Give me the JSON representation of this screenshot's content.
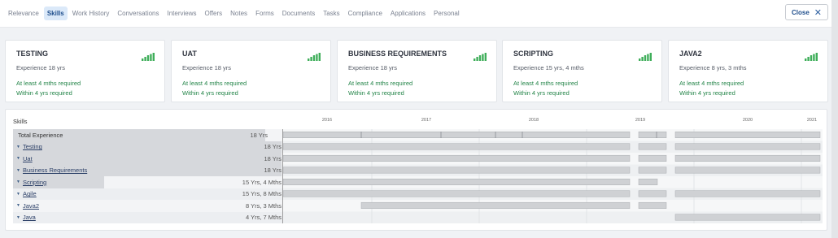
{
  "tabs": [
    "Relevance",
    "Skills",
    "Work History",
    "Conversations",
    "Interviews",
    "Offers",
    "Notes",
    "Forms",
    "Documents",
    "Tasks",
    "Compliance",
    "Applications",
    "Personal"
  ],
  "active_tab": "Skills",
  "close_label": "Close",
  "cards": [
    {
      "title": "TESTING",
      "experience": "Experience 18 yrs",
      "required": "At least 4 mths required",
      "within": "Within 4 yrs required"
    },
    {
      "title": "UAT",
      "experience": "Experience 18 yrs",
      "required": "At least 4 mths required",
      "within": "Within 4 yrs required"
    },
    {
      "title": "BUSINESS REQUIREMENTS",
      "experience": "Experience 18 yrs",
      "required": "At least 4 mths required",
      "within": "Within 4 yrs required"
    },
    {
      "title": "SCRIPTING",
      "experience": "Experience 15 yrs, 4 mths",
      "required": "At least 4 mths required",
      "within": "Within 4 yrs required"
    },
    {
      "title": "JAVA2",
      "experience": "Experience 8 yrs, 3 mths",
      "required": "At least 4 mths required",
      "within": "Within 4 yrs required"
    }
  ],
  "skills_header": "Skills",
  "year_ticks": [
    "2016",
    "2017",
    "2018",
    "2019",
    "2020",
    "2021"
  ],
  "skill_rows": [
    {
      "name": "Total Experience",
      "value": "18 Yrs",
      "total": true,
      "fill": 0.94
    },
    {
      "name": "Testing",
      "value": "18 Yrs",
      "fill": 1.0
    },
    {
      "name": "Uat",
      "value": "18 Yrs",
      "fill": 1.0
    },
    {
      "name": "Business Requirements",
      "value": "18 Yrs",
      "fill": 1.0
    },
    {
      "name": "Scripting",
      "value": "15 Yrs, 4 Mths",
      "fill": 0.34
    },
    {
      "name": "Agile",
      "value": "15 Yrs, 8 Mths",
      "fill": 0.0
    },
    {
      "name": "Java2",
      "value": "8 Yrs, 3 Mths",
      "fill": 0.0
    },
    {
      "name": "Java",
      "value": "4 Yrs, 7 Mths",
      "fill": 0.0
    }
  ],
  "colors": {
    "accent": "#1f4e8c",
    "green": "#238448",
    "bar": "#cfd1d4"
  }
}
